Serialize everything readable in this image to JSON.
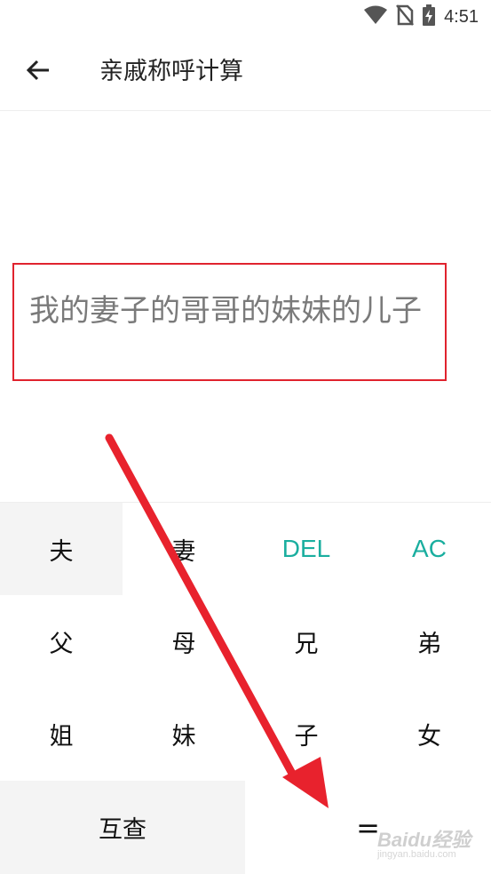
{
  "status_bar": {
    "time": "4:51",
    "icons": [
      "wifi-icon",
      "no-sim-icon",
      "battery-charging-icon"
    ]
  },
  "toolbar": {
    "back_icon": "arrow-left-icon",
    "title": "亲戚称呼计算"
  },
  "display": {
    "text": "我的妻子的哥哥的妹妹的儿子"
  },
  "keypad": {
    "row1": [
      "夫",
      "妻",
      "DEL",
      "AC"
    ],
    "row2": [
      "父",
      "母",
      "兄",
      "弟"
    ],
    "row3": [
      "姐",
      "妹",
      "子",
      "女"
    ],
    "row4": [
      "互查",
      "="
    ]
  },
  "colors": {
    "accent_green": "#1aae9f",
    "annotation_red": "#e0232e",
    "key_pressed_bg": "#f4f4f4"
  },
  "watermark": {
    "text": "Baidu经验",
    "sub": "jingyan.baidu.com"
  }
}
